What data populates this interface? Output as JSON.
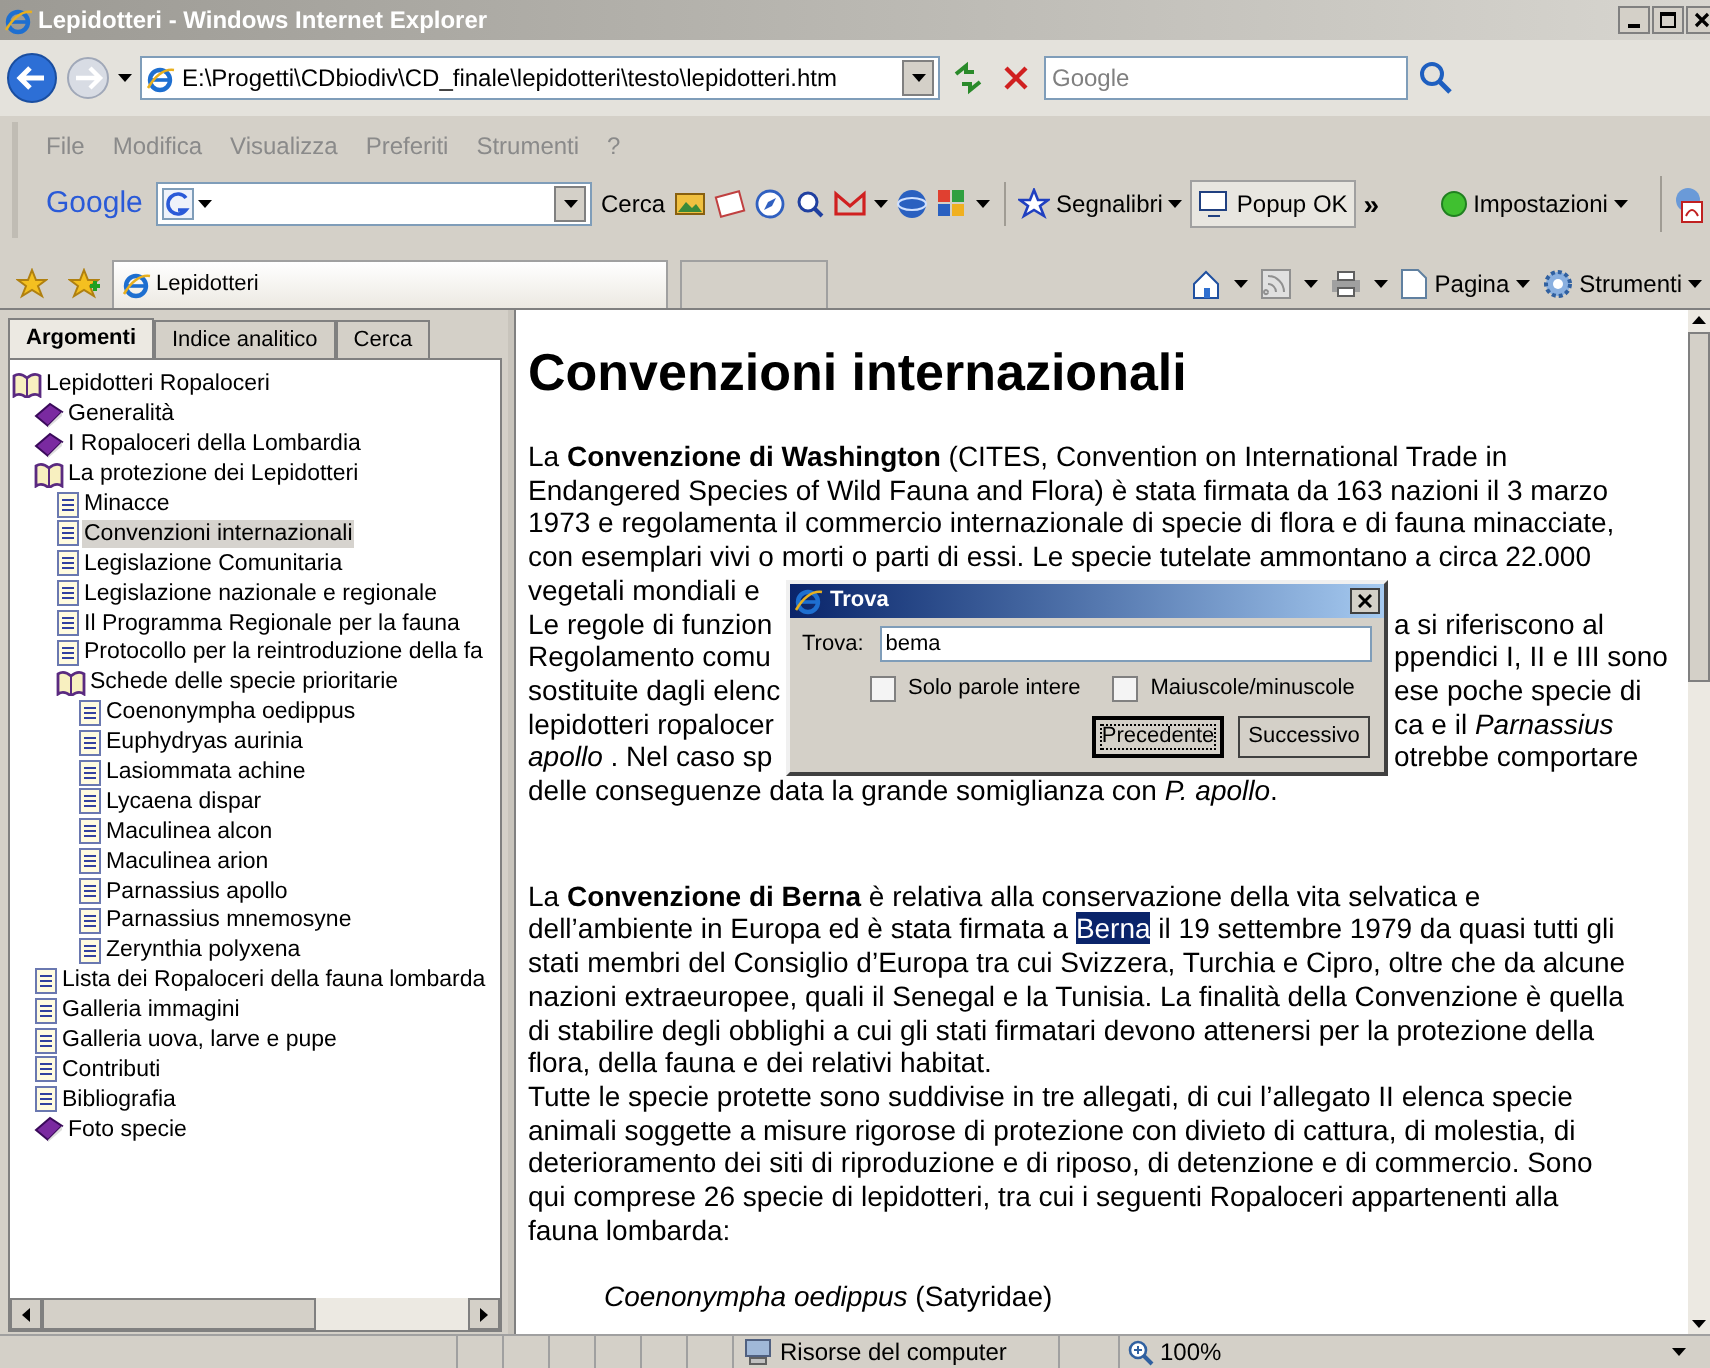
{
  "window": {
    "title": "Lepidotteri - Windows Internet Explorer"
  },
  "address_bar": {
    "url": "E:\\Progetti\\CDbiodiv\\CD_finale\\lepidotteri\\testo\\lepidotteri.htm"
  },
  "search_box": {
    "placeholder": "Google"
  },
  "menu_bar": {
    "items": [
      "File",
      "Modifica",
      "Visualizza",
      "Preferiti",
      "Strumenti",
      "?"
    ]
  },
  "google_toolbar": {
    "logo": "Google",
    "search_label": "Cerca",
    "bookmarks": "Segnalibri",
    "popup": "Popup OK",
    "more": "»",
    "settings": "Impostazioni"
  },
  "tabs": [
    {
      "label": "Lepidotteri",
      "selected": true
    }
  ],
  "command_bar": {
    "items": [
      "Pagina",
      "Strumenti"
    ]
  },
  "help_pane": {
    "tabs": [
      {
        "label": "Argomenti",
        "selected": true
      },
      {
        "label": "Indice analitico",
        "selected": false
      },
      {
        "label": "Cerca",
        "selected": false
      }
    ],
    "tree": [
      {
        "label": "Lepidotteri Ropaloceri",
        "kind": "book",
        "expanded": true,
        "selected": false,
        "children": [
          {
            "label": "Generalità",
            "kind": "book",
            "expanded": false,
            "selected": false
          },
          {
            "label": "I Ropaloceri della Lombardia",
            "kind": "book",
            "expanded": false,
            "selected": false
          },
          {
            "label": "La protezione dei Lepidotteri",
            "kind": "book",
            "expanded": true,
            "selected": false,
            "children": [
              {
                "label": "Minacce",
                "kind": "page",
                "selected": false
              },
              {
                "label": "Convenzioni internazionali",
                "kind": "page",
                "selected": true
              },
              {
                "label": "Legislazione Comunitaria",
                "kind": "page",
                "selected": false
              },
              {
                "label": "Legislazione nazionale e regionale",
                "kind": "page",
                "selected": false
              },
              {
                "label": "Il Programma Regionale per la fauna",
                "kind": "page",
                "selected": false
              },
              {
                "label": "Protocollo per la reintroduzione della fa",
                "kind": "page",
                "selected": false
              },
              {
                "label": "Schede delle specie prioritarie",
                "kind": "book",
                "expanded": true,
                "selected": false,
                "children": [
                  {
                    "label": "Coenonympha oedippus",
                    "kind": "page",
                    "selected": false
                  },
                  {
                    "label": "Euphydryas aurinia",
                    "kind": "page",
                    "selected": false
                  },
                  {
                    "label": "Lasiommata achine",
                    "kind": "page",
                    "selected": false
                  },
                  {
                    "label": "Lycaena dispar",
                    "kind": "page",
                    "selected": false
                  },
                  {
                    "label": "Maculinea alcon",
                    "kind": "page",
                    "selected": false
                  },
                  {
                    "label": "Maculinea arion",
                    "kind": "page",
                    "selected": false
                  },
                  {
                    "label": "Parnassius apollo",
                    "kind": "page",
                    "selected": false
                  },
                  {
                    "label": "Parnassius mnemosyne",
                    "kind": "page",
                    "selected": false
                  },
                  {
                    "label": "Zerynthia polyxena",
                    "kind": "page",
                    "selected": false
                  }
                ]
              }
            ]
          },
          {
            "label": "Lista dei Ropaloceri della fauna lombarda",
            "kind": "page",
            "selected": false
          },
          {
            "label": "Galleria immagini",
            "kind": "page",
            "selected": false
          },
          {
            "label": "Galleria uova, larve e pupe",
            "kind": "page",
            "selected": false
          },
          {
            "label": "Contributi",
            "kind": "page",
            "selected": false
          },
          {
            "label": "Bibliografia",
            "kind": "page",
            "selected": false
          },
          {
            "label": "Foto specie",
            "kind": "book",
            "expanded": false,
            "selected": false
          }
        ]
      }
    ]
  },
  "content": {
    "blocks": [
      {
        "kind": "heading",
        "text": "Convenzioni internazionali"
      },
      {
        "kind": "lines",
        "lines": [
          {
            "kind": "full",
            "text": "La **Convenzione di Washington** (CITES, Convention on International Trade in"
          },
          {
            "kind": "full",
            "text": "Endangered Species of Wild Fauna and Flora) è stata firmata da 163 nazioni il 3 marzo"
          },
          {
            "kind": "full",
            "text": "1973 e regolamenta il commercio internazionale di specie di flora e di fauna minacciate,"
          },
          {
            "kind": "full",
            "text": "con esemplari vivi o morti o parti di essi. Le specie tutelate ammontano a circa 22.000"
          },
          {
            "kind": "full",
            "text": "vegetali mondiali e"
          },
          {
            "kind": "split",
            "left": "Le regole di funzion",
            "right": "a si riferiscono al"
          },
          {
            "kind": "split",
            "left": "Regolamento comu",
            "right": "ppendici I, II e III sono"
          },
          {
            "kind": "split",
            "left": "sostituite dagli elenc",
            "right": "ese poche specie di"
          },
          {
            "kind": "split",
            "left": "lepidotteri ropalocer",
            "right": "ca e il *Parnassius*"
          },
          {
            "kind": "split",
            "left": "*apollo* . Nel caso sp",
            "right": "otrebbe comportare"
          },
          {
            "kind": "full",
            "text": "delle conseguenze data la grande somiglianza con *P. apollo*."
          }
        ]
      },
      {
        "kind": "lines",
        "lines": [
          {
            "kind": "full",
            "text": "La **Convenzione di Berna** è relativa alla conservazione della vita selvatica e"
          },
          {
            "kind": "match",
            "before": "dell’ambiente in Europa ed è stata firmata a ",
            "match": "Berna",
            "after": " il 19 settembre 1979 da quasi tutti gli"
          },
          {
            "kind": "full",
            "text": "stati membri del Consiglio d’Europa tra cui Svizzera, Turchia e Cipro, oltre che da alcune"
          },
          {
            "kind": "full",
            "text": "nazioni extraeuropee, quali il Senegal e la Tunisia. La finalità della Convenzione è quella"
          },
          {
            "kind": "full",
            "text": "di stabilire degli obblighi a cui gli stati firmatari devono attenersi per la protezione della"
          },
          {
            "kind": "full",
            "text": "flora, della fauna e dei relativi habitat."
          },
          {
            "kind": "full",
            "text": "Tutte le specie protette sono suddivise in tre allegati, di cui l’allegato II elenca specie"
          },
          {
            "kind": "full",
            "text": "animali soggette a misure rigorose di protezione con divieto di cattura, di molestia, di"
          },
          {
            "kind": "full",
            "text": "deterioramento dei siti di riproduzione e di riposo, di detenzione e di commercio. Sono"
          },
          {
            "kind": "full",
            "text": "qui comprese 26 specie di lepidotteri, tra cui i seguenti Ropaloceri appartenenti alla"
          },
          {
            "kind": "full",
            "text": "fauna lombarda:"
          }
        ]
      },
      {
        "kind": "list",
        "items": [
          "*Coenonympha oedippus* (Satyridae)"
        ]
      }
    ]
  },
  "find_dialog": {
    "title": "Trova",
    "field_label": "Trova:",
    "value": "bema",
    "options": [
      {
        "label": "Solo parole intere",
        "checked": false
      },
      {
        "label": "Maiuscole/minuscole",
        "checked": false
      }
    ],
    "buttons": [
      {
        "label": "Precedente",
        "default": true
      },
      {
        "label": "Successivo",
        "default": false
      }
    ]
  },
  "status_bar": {
    "zone": "Risorse del computer",
    "zoom": "100%"
  }
}
